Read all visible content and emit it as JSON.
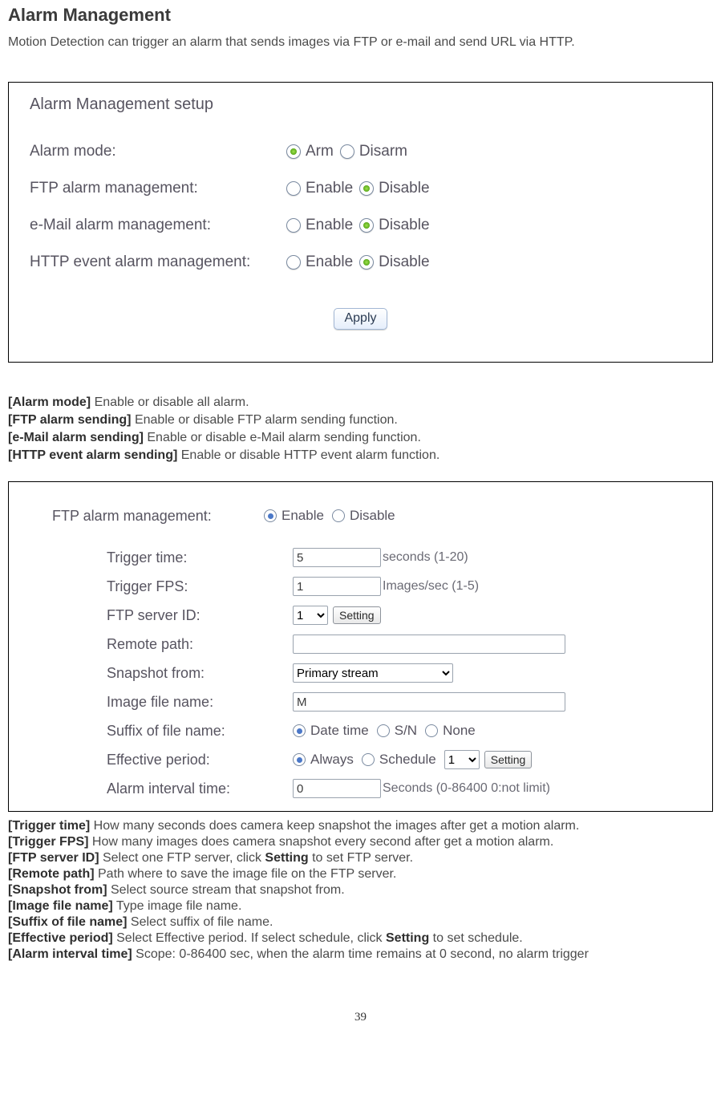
{
  "title": "Alarm Management",
  "intro": "Motion Detection can trigger an alarm that sends images via FTP or e-mail and send URL via HTTP.",
  "shot1": {
    "header": "Alarm Management setup",
    "rows": {
      "alarm_mode": {
        "label": "Alarm mode:",
        "opt1": "Arm",
        "opt2": "Disarm"
      },
      "ftp": {
        "label": "FTP alarm management:",
        "opt1": "Enable",
        "opt2": "Disable"
      },
      "email": {
        "label": "e-Mail alarm management:",
        "opt1": "Enable",
        "opt2": "Disable"
      },
      "http": {
        "label": "HTTP event alarm management:",
        "opt1": "Enable",
        "opt2": "Disable"
      }
    },
    "apply": "Apply"
  },
  "defs": {
    "alarm_mode_k": "[Alarm mode]",
    "alarm_mode_v": " Enable or disable all alarm.",
    "ftp_k": "[FTP alarm sending]",
    "ftp_v": " Enable or disable FTP alarm sending function.",
    "email_k": "[e-Mail alarm sending]",
    "email_v": " Enable or disable e-Mail alarm sending function.",
    "http_k": "[HTTP event alarm sending]",
    "http_v": " Enable or disable HTTP event alarm function."
  },
  "shot2": {
    "ftp_mgmt": {
      "label": "FTP alarm management:",
      "opt1": "Enable",
      "opt2": "Disable"
    },
    "trigger_time": {
      "label": "Trigger time:",
      "value": "5",
      "note": "seconds (1-20)"
    },
    "trigger_fps": {
      "label": "Trigger FPS:",
      "value": "1",
      "note": "Images/sec (1-5)"
    },
    "server_id": {
      "label": "FTP server ID:",
      "value": "1",
      "btn": "Setting"
    },
    "remote_path": {
      "label": "Remote path:",
      "value": ""
    },
    "snapshot": {
      "label": "Snapshot from:",
      "value": "Primary stream"
    },
    "img_name": {
      "label": "Image file name:",
      "value": "M"
    },
    "suffix": {
      "label": "Suffix of file name:",
      "o1": "Date time",
      "o2": "S/N",
      "o3": "None"
    },
    "eff": {
      "label": "Effective period:",
      "o1": "Always",
      "o2": "Schedule",
      "sel": "1",
      "btn": "Setting"
    },
    "interval": {
      "label": "Alarm interval time:",
      "value": "0",
      "note": "Seconds (0-86400 0:not limit)"
    }
  },
  "defs2": {
    "tt_k": "[Trigger time]",
    "tt_v": " How many seconds does camera keep snapshot the images after get a motion alarm.",
    "tf_k": "[Trigger FPS]",
    "tf_v": " How many images does camera snapshot every second after get a motion alarm.",
    "sid_k": "[FTP server ID]",
    "sid_v1": " Select one FTP server, click ",
    "sid_b": "Setting",
    "sid_v2": " to set FTP server.",
    "rp_k": "[Remote path]",
    "rp_v": " Path where to save the image file on the FTP server.",
    "sf_k": "[Snapshot from]",
    "sf_v": " Select source stream that snapshot from.",
    "ifn_k": "[Image file name]",
    "ifn_v": " Type image file name.",
    "suf_k": "[Suffix of file name]",
    "suf_v": " Select suffix of file name.",
    "ep_k": "[Effective period]",
    "ep_v1": " Select Effective period. If select schedule, click ",
    "ep_b": "Setting",
    "ep_v2": " to set schedule.",
    "ai_k": "[Alarm interval time]",
    "ai_v": " Scope: 0-86400 sec, when the alarm time remains at 0 second, no alarm trigger"
  },
  "page_number": "39"
}
